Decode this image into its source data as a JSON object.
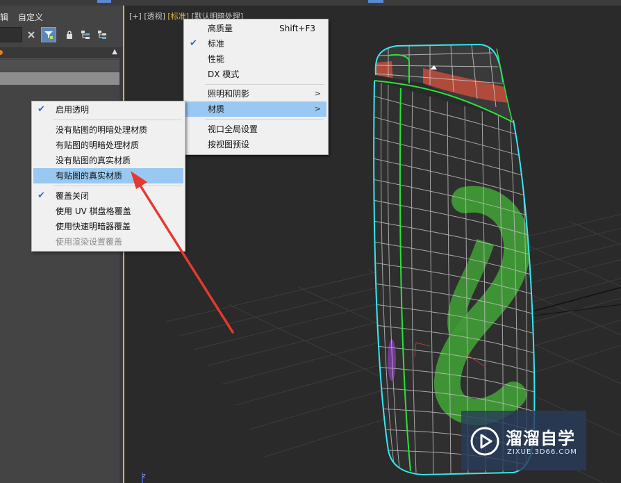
{
  "menubar": {
    "item_partial": "辑",
    "item_custom": "自定义"
  },
  "viewport": {
    "label_plus": "[+]",
    "label_view": "[透视]",
    "label_shading": "[标准]",
    "label_lighting": "[默认明暗处理]",
    "axis_label": "z"
  },
  "menu_main": {
    "items": [
      {
        "label": "高质量",
        "shortcut": "Shift+F3"
      },
      {
        "label": "标准",
        "checked": true
      },
      {
        "label": "性能"
      },
      {
        "label": "DX 模式"
      },
      {
        "label": "照明和阴影",
        "submenu": true
      },
      {
        "label": "材质",
        "submenu": true,
        "highlighted": true
      },
      {
        "label": "视口全局设置"
      },
      {
        "label": "按视图预设"
      }
    ]
  },
  "menu_sub": {
    "items": [
      {
        "label": "启用透明",
        "checked": true
      },
      {
        "label": "没有贴图的明暗处理材质"
      },
      {
        "label": "有贴图的明暗处理材质"
      },
      {
        "label": "没有贴图的真实材质"
      },
      {
        "label": "有贴图的真实材质",
        "highlighted": true
      },
      {
        "label": "覆盖关闭",
        "checked": true
      },
      {
        "label": "使用 UV 棋盘格覆盖"
      },
      {
        "label": "使用快速明暗器覆盖"
      },
      {
        "label": "使用渲染设置覆盖",
        "disabled": true
      }
    ]
  },
  "icons": {
    "check": "check-icon",
    "submenu": "chevron-right-icon",
    "clear": "close-icon",
    "filter": "filter-icon",
    "lock": "lock-icon",
    "hierarchy_a": "hierarchy-icon",
    "hierarchy_b": "hierarchy-alt-icon"
  },
  "colors": {
    "active_border": "#e0b44a",
    "menu_highlight": "#99c9f2",
    "annotation_arrow": "#e53a2e"
  },
  "watermark": {
    "title": "溜溜自学",
    "url": "ZIXUE.3D66.COM"
  }
}
